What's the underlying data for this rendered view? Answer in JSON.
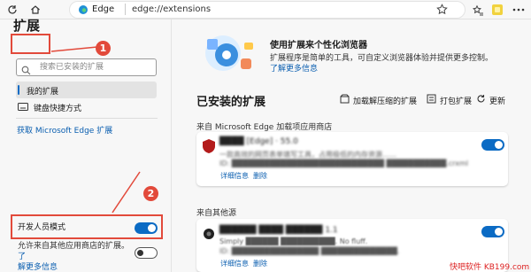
{
  "browser": {
    "app_name": "Edge",
    "url": "edge://extensions"
  },
  "sidebar": {
    "title": "扩展",
    "search_placeholder": "搜索已安装的扩展",
    "nav_items": [
      {
        "label": "我的扩展"
      },
      {
        "label": "键盘快捷方式"
      }
    ],
    "get_extensions_link": "获取 Microsoft Edge 扩展",
    "dev_mode_label": "开发人员模式",
    "dev_mode_on": true,
    "allow_other_stores_text": "允许来自其他应用商店的扩展。",
    "allow_other_stores_link_1": "了",
    "allow_other_stores_link_2": "解更多信息",
    "allow_other_stores_on": false
  },
  "annotations": {
    "badge_1": "1",
    "badge_2": "2",
    "accent_color": "#e24a3b"
  },
  "promo": {
    "title": "使用扩展来个性化浏览器",
    "description": "扩展程序是简单的工具，可自定义浏览器体验并提供更多控制。",
    "link": "了解更多信息"
  },
  "installed": {
    "title": "已安装的扩展",
    "actions": {
      "load_unpacked": "加载解压缩的扩展",
      "pack": "打包扩展",
      "update": "更新"
    }
  },
  "sections": [
    {
      "title": "来自 Microsoft Edge 加载项应用商店",
      "extension": {
        "name": "████ [Edge] · 55.0",
        "description": "一款高效的网页表单填写工具，占用极低的内存资源……",
        "id_line": "ID: ████████████████████████████ ███████████.crxml",
        "details": "详细信息",
        "remove": "删除",
        "enabled": true
      }
    },
    {
      "title": "来自其他源",
      "extension": {
        "name": "██████ ████ ██████ 1.1",
        "description": "Simply ██████ ██████████. No fluff.",
        "id_line": "ID: ████████████████ ██████████████.",
        "details": "详细信息",
        "remove": "删除",
        "enabled": true
      }
    }
  ],
  "watermark": "快吧软件 KB199.com"
}
